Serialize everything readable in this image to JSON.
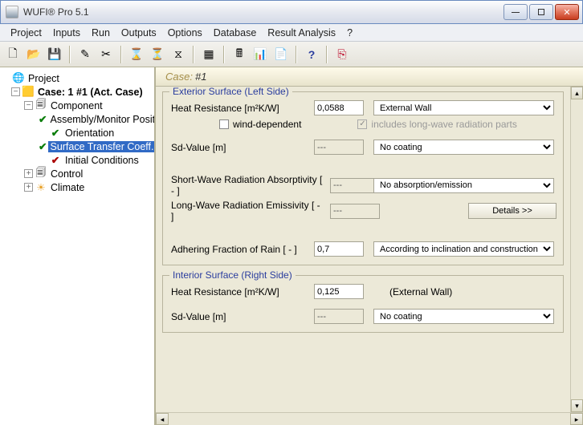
{
  "window": {
    "title": "WUFI® Pro 5.1"
  },
  "menu": {
    "project": "Project",
    "inputs": "Inputs",
    "run": "Run",
    "outputs": "Outputs",
    "options": "Options",
    "database": "Database",
    "result_analysis": "Result Analysis",
    "help": "?"
  },
  "tree": {
    "root": "Project",
    "case": "Case: 1 #1 (Act. Case)",
    "component": "Component",
    "assembly": "Assembly/Monitor Positions",
    "orientation": "Orientation",
    "stc": "Surface Transfer Coeff.",
    "initial": "Initial Conditions",
    "control": "Control",
    "climate": "Climate"
  },
  "case_header": {
    "prefix": "Case:",
    "num": "#1"
  },
  "exterior": {
    "legend": "Exterior Surface (Left Side)",
    "heat_res_label": "Heat Resistance [m²K/W]",
    "heat_res_value": "0,0588",
    "heat_res_select": "External Wall",
    "wind_label": "wind-dependent",
    "longwave_label": "includes long-wave radiation parts",
    "sd_label": "Sd-Value  [m]",
    "sd_value": "---",
    "sd_select": "No coating",
    "short_label": "Short-Wave Radiation Absorptivity [ - ]",
    "short_value": "---",
    "short_select": "No absorption/emission",
    "long_label": "Long-Wave Radiation Emissivity [ - ]",
    "long_value": "---",
    "details_btn": "Details >>",
    "rain_label": "Adhering Fraction of Rain [ - ]",
    "rain_value": "0,7",
    "rain_select": "According to inclination and construction type"
  },
  "interior": {
    "legend": "Interior Surface (Right Side)",
    "heat_res_label": "Heat Resistance [m²K/W]",
    "heat_res_value": "0,125",
    "heat_res_note": "(External Wall)",
    "sd_label": "Sd-Value  [m]",
    "sd_value": "---",
    "sd_select": "No coating"
  }
}
